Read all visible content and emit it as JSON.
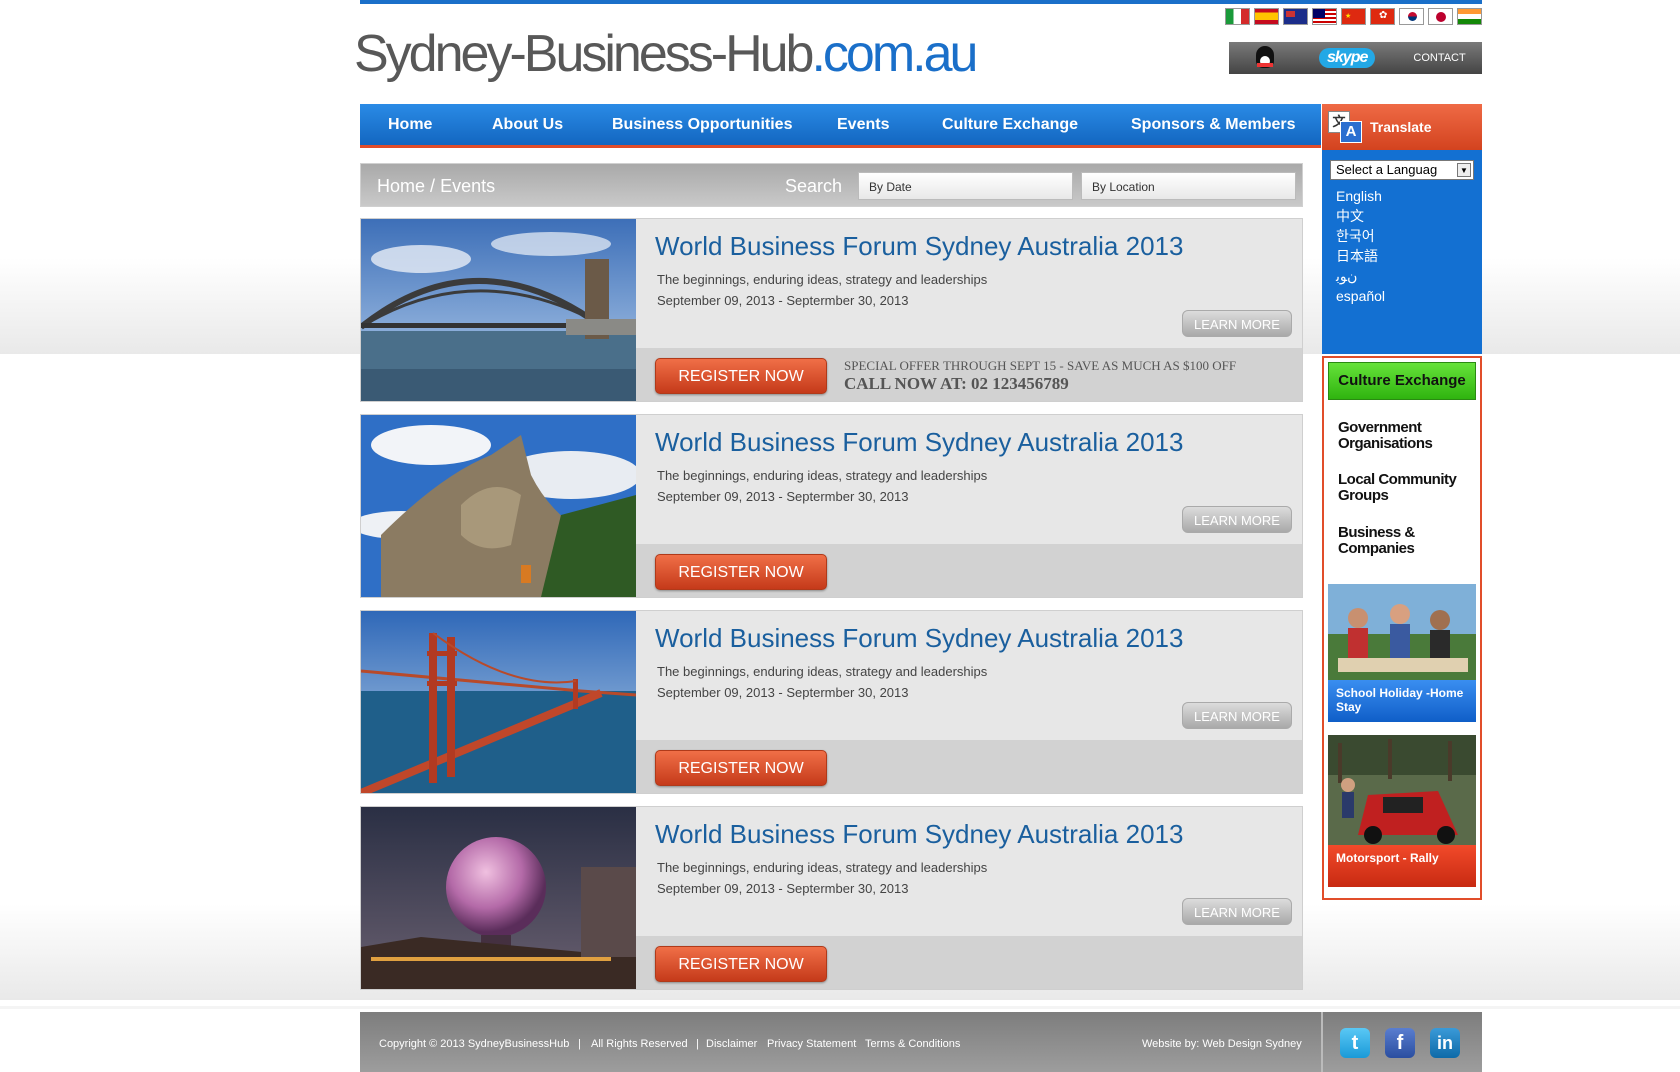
{
  "site": {
    "logo_main": "Sydney-Business-Hub",
    "logo_domain": ".com.au",
    "contact_label": "CONTACT",
    "skype_label": "skype"
  },
  "flags": [
    "italy-flag",
    "spain-flag",
    "australia-flag",
    "malaysia-flag",
    "china-flag",
    "hongkong-flag",
    "korea-flag",
    "japan-flag",
    "india-flag"
  ],
  "nav": {
    "items": [
      "Home",
      "About Us",
      "Business Opportunities",
      "Events",
      "Culture Exchange",
      "Sponsors & Members"
    ]
  },
  "breadcrumb": {
    "home": "Home",
    "sep": "/",
    "current": "Events"
  },
  "search": {
    "label": "Search",
    "by_date": "By Date",
    "by_location": "By Location"
  },
  "events": [
    {
      "title": "World Business Forum Sydney Australia 2013",
      "desc": "The beginnings, enduring ideas, strategy and leaderships",
      "dates": "September 09, 2013 - Septermber 30, 2013",
      "learn": "LEARN MORE",
      "register": "REGISTER NOW",
      "offer": "SPECIAL OFFER THROUGH SEPT 15 - SAVE AS MUCH AS $100 OFF",
      "call": "CALL NOW AT: 02 123456789"
    },
    {
      "title": "World Business Forum Sydney Australia 2013",
      "desc": "The beginnings, enduring ideas, strategy and leaderships",
      "dates": "September 09, 2013 - Septermber 30, 2013",
      "learn": "LEARN MORE",
      "register": "REGISTER NOW"
    },
    {
      "title": "World Business Forum Sydney Australia 2013",
      "desc": "The beginnings, enduring ideas, strategy and leaderships",
      "dates": "September 09, 2013 - Septermber 30, 2013",
      "learn": "LEARN MORE",
      "register": "REGISTER NOW"
    },
    {
      "title": "World Business Forum Sydney Australia 2013",
      "desc": "The beginnings, enduring ideas, strategy and leaderships",
      "dates": "September 09, 2013 - Septermber 30, 2013",
      "learn": "LEARN MORE",
      "register": "REGISTER NOW"
    }
  ],
  "translate": {
    "title": "Translate",
    "select_value": "Select a Languag",
    "languages": [
      "English",
      "中文",
      "한국어",
      "日本語",
      "ﻥﻮﺑ",
      "español"
    ]
  },
  "culture": {
    "title": "Culture Exchange",
    "links": [
      "Government Organisations",
      "Local Community Groups",
      "Business & Companies"
    ],
    "promo1": "School Holiday -Home Stay",
    "promo2": "Motorsport - Rally"
  },
  "footer": {
    "copyright": "Copyright © 2013 SydneyBusinessHub",
    "rights": "All Rights Reserved",
    "disclaimer": "Disclaimer",
    "privacy": "Privacy Statement",
    "terms": "Terms & Conditions",
    "credit": "Website by: Web Design Sydney"
  },
  "colors": {
    "brand_blue": "#1a6fc9",
    "accent_red": "#e14d2a",
    "accent_green": "#3fc41a"
  }
}
